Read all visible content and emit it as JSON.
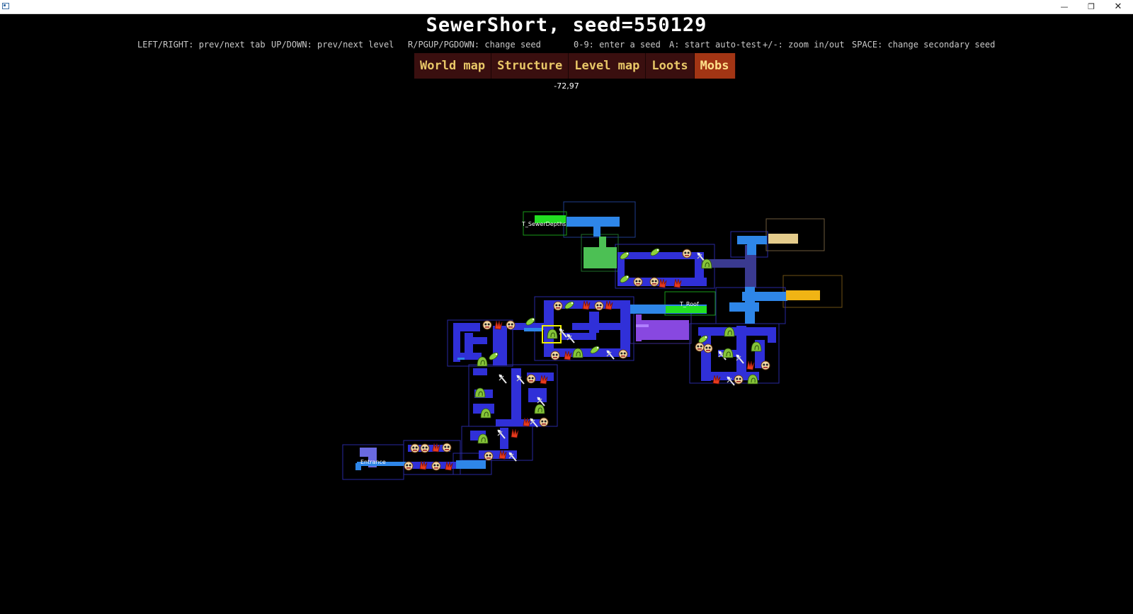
{
  "window": {
    "minimize_glyph": "—",
    "maximize_glyph": "❐",
    "close_glyph": "✕",
    "icon": "app-window-icon"
  },
  "title": "SewerShort, seed=550129",
  "help": [
    {
      "key": "left-right",
      "text": "LEFT/RIGHT: prev/next tab"
    },
    {
      "key": "up-down",
      "text": "UP/DOWN: prev/next level"
    },
    {
      "key": "change-seed",
      "text": "R/PGUP/PGDOWN: change seed"
    },
    {
      "key": "enter-seed",
      "text": "0-9: enter a seed"
    },
    {
      "key": "auto-test",
      "text": "A: start auto-test"
    },
    {
      "key": "zoom",
      "text": "+/-: zoom in/out"
    },
    {
      "key": "secondary-seed",
      "text": "SPACE: change secondary seed"
    }
  ],
  "tabs": [
    {
      "key": "world-map",
      "label": "World map",
      "active": false
    },
    {
      "key": "structure",
      "label": "Structure",
      "active": false
    },
    {
      "key": "level-map",
      "label": "Level map",
      "active": false
    },
    {
      "key": "loots",
      "label": "Loots",
      "active": false
    },
    {
      "key": "mobs",
      "label": "Mobs",
      "active": true
    }
  ],
  "cursor_coords": "-72,97",
  "map": {
    "labels": {
      "sewer_depths": "T_SewerDepths",
      "roof": "T_Roof",
      "entrance": "Entrance"
    },
    "colors": {
      "background": "#000000",
      "room_blue": "#3030d8",
      "corridor_blue": "#2e86e8",
      "dark_corridor": "#3a3a90",
      "purple_room": "#8848e0",
      "exit_green": "#22e022",
      "room_green": "#4cc054",
      "tan_room": "#e4cc8c",
      "gold_room": "#f0b414",
      "highlight_yellow": "#f0f000",
      "tab_bg": "#3a0f0f",
      "tab_active_bg": "#a23514",
      "tab_text": "#e9c868"
    },
    "mob_icons": [
      "zombie-face-icon",
      "red-claw-icon",
      "green-larva-icon",
      "skeleton-sword-icon",
      "green-slime-icon"
    ]
  }
}
